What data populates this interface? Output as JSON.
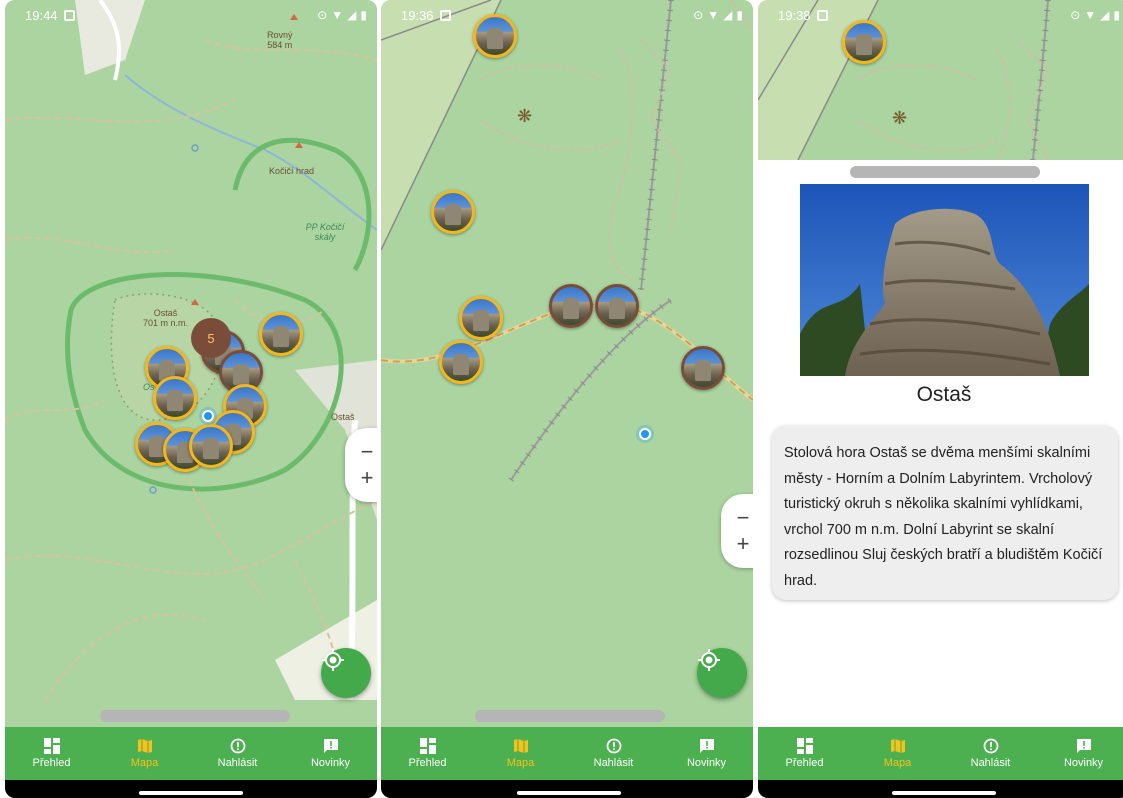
{
  "screens": [
    {
      "status": {
        "time": "19:44"
      },
      "map_labels": {
        "rovny": "Rovný",
        "rovny_elev": "584 m",
        "kocici_hrad": "Kočičí hrad",
        "pp_kocici_skaly": "PP Kočičí skály",
        "ostas_peak": "Ostaš",
        "ostas_peak_elev": "701 m n.m.",
        "ostas_village": "Ostaš",
        "ostas_partial": "Os"
      },
      "cluster_count": "5"
    },
    {
      "status": {
        "time": "19:36"
      }
    },
    {
      "status": {
        "time": "19:38"
      },
      "detail": {
        "title": "Ostaš",
        "description": "Stolová hora Ostaš se dvěma menšími skalními městy - Horním a Dolním Labyrintem. Vrcholový turistický okruh s několika skalními vyhlídkami, vrchol 700 m n.m. Dolní Labyrint se skalní rozsedlinou Sluj českých bratří a bludištěm Kočičí hrad."
      }
    }
  ],
  "zoom": {
    "minus": "−",
    "plus": "+"
  },
  "bottom_nav": {
    "items": [
      {
        "label": "Přehled",
        "icon": "dashboard-icon"
      },
      {
        "label": "Mapa",
        "icon": "map-icon",
        "active": true
      },
      {
        "label": "Nahlásit",
        "icon": "report-icon"
      },
      {
        "label": "Novinky",
        "icon": "announcement-icon"
      }
    ]
  },
  "colors": {
    "nav_bg": "#4caf50",
    "nav_active": "#f6c21a",
    "map_bg": "#abd4a0",
    "marker_border": "#f3b61b",
    "marker_border_alt": "#7a4d3a",
    "locate_btn": "#43a94b"
  }
}
